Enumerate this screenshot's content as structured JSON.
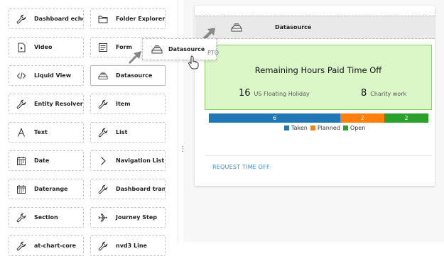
{
  "palette": {
    "tiles": [
      {
        "label": "Dashboard echo",
        "icon": "wrench-icon"
      },
      {
        "label": "Folder Explorer",
        "icon": "folder-icon"
      },
      {
        "label": "Video",
        "icon": "video-file-icon"
      },
      {
        "label": "Form",
        "icon": "form-icon"
      },
      {
        "label": "Liquid View",
        "icon": "code-icon"
      },
      {
        "label": "Datasource",
        "icon": "datasource-icon"
      },
      {
        "label": "Entity Resolver",
        "icon": "wrench-icon"
      },
      {
        "label": "Item",
        "icon": "wrench-icon"
      },
      {
        "label": "Text",
        "icon": "text-icon"
      },
      {
        "label": "List",
        "icon": "wrench-icon"
      },
      {
        "label": "Date",
        "icon": "calendar-icon"
      },
      {
        "label": "Navigation List",
        "icon": "chevron-right-icon"
      },
      {
        "label": "Daterange",
        "icon": "calendar-icon"
      },
      {
        "label": "Dashboard transf...",
        "icon": "wrench-icon"
      },
      {
        "label": "Section",
        "icon": "wrench-icon"
      },
      {
        "label": "Journey Step",
        "icon": "airplane-icon"
      },
      {
        "label": "at-chart-core",
        "icon": "wrench-icon"
      },
      {
        "label": "nvd3 Line",
        "icon": "wrench-icon"
      }
    ]
  },
  "drag": {
    "ghost_label": "Datasource",
    "dropzone_label": "Datasource"
  },
  "widget": {
    "tag": "PTO",
    "title": "Remaining Hours Paid Time Off",
    "stats": [
      {
        "value": "16",
        "label": "US Floating Holiday"
      },
      {
        "value": "8",
        "label": "Charity work"
      }
    ],
    "bar": [
      {
        "name": "Taken",
        "value": 6,
        "display": "6",
        "color": "#1f77b4"
      },
      {
        "name": "Planned",
        "value": 2,
        "display": "2",
        "color": "#ff7f0e"
      },
      {
        "name": "Open",
        "value": 2,
        "display": "2",
        "color": "#2ca02c"
      }
    ],
    "link": "REQUEST TIME OFF"
  }
}
